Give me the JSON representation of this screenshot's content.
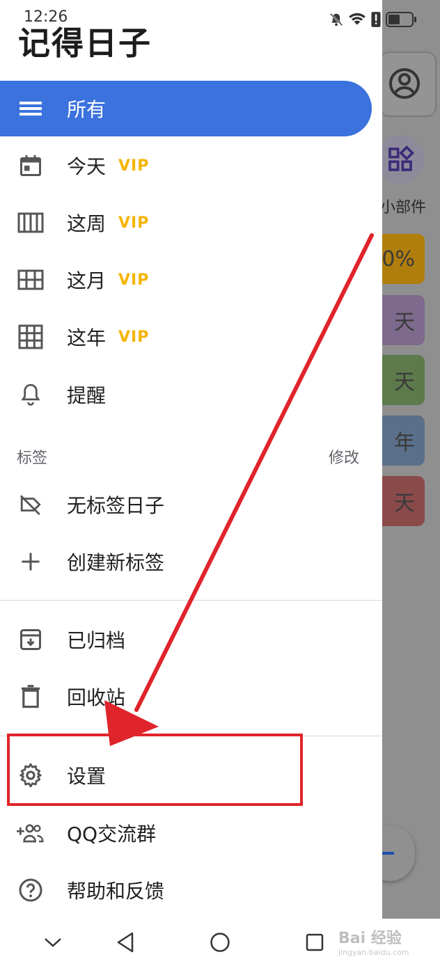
{
  "status_bar": {
    "time": "12:26"
  },
  "drawer": {
    "title": "记得日子",
    "items": [
      {
        "label": "所有",
        "icon": "list-icon",
        "selected": true
      },
      {
        "label": "今天",
        "badge": "VIP",
        "icon": "calendar-day-icon"
      },
      {
        "label": "这周",
        "badge": "VIP",
        "icon": "calendar-week-icon"
      },
      {
        "label": "这月",
        "badge": "VIP",
        "icon": "calendar-month-icon"
      },
      {
        "label": "这年",
        "badge": "VIP",
        "icon": "calendar-year-icon"
      },
      {
        "label": "提醒",
        "icon": "bell-icon"
      }
    ],
    "tags_section": {
      "header": "标签",
      "action": "修改"
    },
    "tag_items": [
      {
        "label": "无标签日子",
        "icon": "label-off-icon"
      },
      {
        "label": "创建新标签",
        "icon": "plus-icon"
      }
    ],
    "misc_items": [
      {
        "label": "已归档",
        "icon": "archive-icon"
      },
      {
        "label": "回收站",
        "icon": "trash-icon"
      }
    ],
    "bottom_items": [
      {
        "label": "设置",
        "icon": "gear-icon"
      },
      {
        "label": "QQ交流群",
        "icon": "group-add-icon"
      },
      {
        "label": "帮助和反馈",
        "icon": "help-icon"
      }
    ]
  },
  "background": {
    "widget_label": "小部件",
    "cards": [
      {
        "text": "0%",
        "color": "#b07e0c"
      },
      {
        "text": "天",
        "color": "#7d6a8c"
      },
      {
        "text": "天",
        "color": "#5c7a4b"
      },
      {
        "text": "年",
        "color": "#5a6f8a"
      },
      {
        "text": "天",
        "color": "#8a4a4a"
      }
    ]
  },
  "annotation": {
    "highlight_color": "#e0242b",
    "target": "设置"
  },
  "watermark": {
    "text": "Bai 经验",
    "sub": "jingyan.baidu.com"
  }
}
